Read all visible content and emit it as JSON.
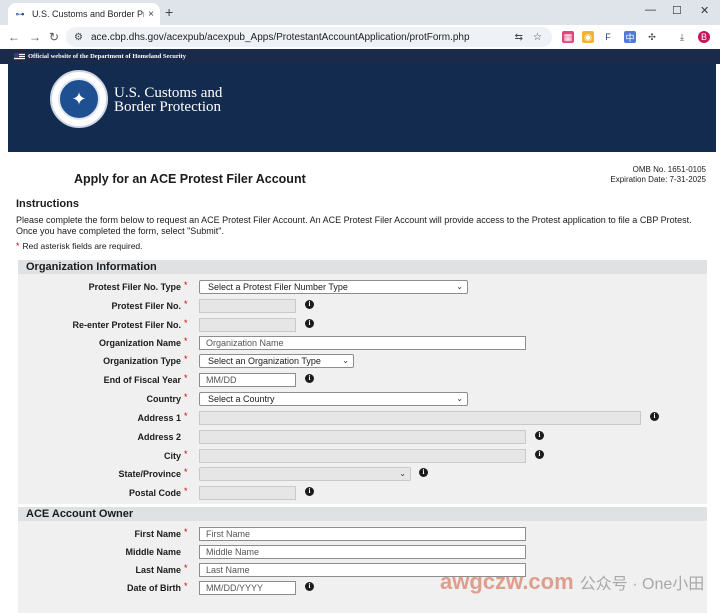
{
  "browser": {
    "tab_title": "U.S. Customs and Border Pro",
    "new_tab": "+",
    "close_tab": "×",
    "window_controls": {
      "minimize": "—",
      "maximize": "☐",
      "close": "✕"
    },
    "url": "ace.cbp.dhs.gov/acexpub/acexpub_Apps/ProtestantAccountApplication/protForm.php",
    "profile_initial": "B"
  },
  "site": {
    "gov_banner": "Official website of the Department of Homeland Security",
    "agency_line1": "U.S. Customs and",
    "agency_line2": "Border Protection"
  },
  "page": {
    "title": "Apply for an ACE Protest Filer Account",
    "omb_no": "OMB No. 1651-0105",
    "expiration": "Expiration Date: 7-31-2025",
    "instructions_heading": "Instructions",
    "instructions_text": "Please complete the form below to request an ACE Protest Filer Account. An ACE Protest Filer Account will provide access to the Protest application to file a CBP Protest. Once you have completed the form, select \"Submit\".",
    "required_note": "Red asterisk fields are required.",
    "required_marker": "*"
  },
  "org_section": {
    "heading": "Organization Information",
    "fields": {
      "protest_filer_type": {
        "label": "Protest Filer No. Type",
        "value": "Select a Protest Filer Number Type"
      },
      "protest_filer_no": {
        "label": "Protest Filer No.",
        "value": ""
      },
      "reenter_filer_no": {
        "label": "Re-enter Protest Filer No.",
        "value": ""
      },
      "org_name": {
        "label": "Organization Name",
        "placeholder": "Organization Name"
      },
      "org_type": {
        "label": "Organization Type",
        "value": "Select an Organization Type"
      },
      "fiscal_year_end": {
        "label": "End of Fiscal Year",
        "placeholder": "MM/DD"
      },
      "country": {
        "label": "Country",
        "value": "Select a Country"
      },
      "address1": {
        "label": "Address 1",
        "value": ""
      },
      "address2": {
        "label": "Address 2",
        "value": ""
      },
      "city": {
        "label": "City",
        "value": ""
      },
      "state": {
        "label": "State/Province",
        "value": ""
      },
      "postal": {
        "label": "Postal Code",
        "value": ""
      }
    }
  },
  "owner_section": {
    "heading": "ACE Account Owner",
    "fields": {
      "first_name": {
        "label": "First Name",
        "placeholder": "First Name"
      },
      "middle_name": {
        "label": "Middle Name",
        "placeholder": "Middle Name"
      },
      "last_name": {
        "label": "Last Name",
        "placeholder": "Last Name"
      },
      "dob": {
        "label": "Date of Birth",
        "placeholder": "MM/DD/YYYY"
      }
    }
  },
  "watermark": {
    "text": "awgczw.com",
    "cn": "公众号 · One小田"
  },
  "icons": {
    "info": "i",
    "caret": "⌄"
  }
}
